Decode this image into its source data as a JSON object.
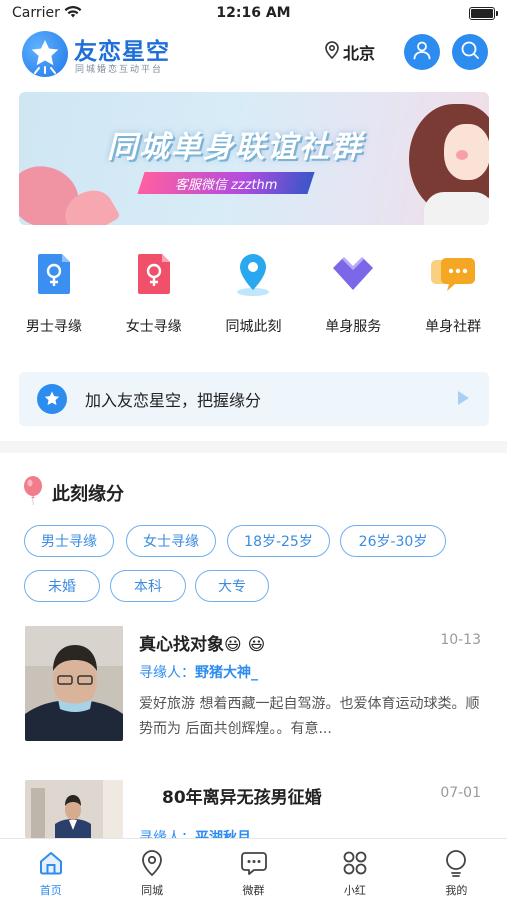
{
  "status_bar": {
    "carrier": "Carrier",
    "time": "12:16 AM"
  },
  "header": {
    "app_name": "友恋星空",
    "subtitle": "同城婚恋互动平台",
    "city": "北京"
  },
  "banner": {
    "title": "同城单身联谊社群",
    "ribbon": "客服微信 zzzthm"
  },
  "nav_items": [
    {
      "label": "男士寻缘",
      "icon": "male-icon",
      "color": "#3a8ff0"
    },
    {
      "label": "女士寻缘",
      "icon": "female-icon",
      "color": "#f0506a"
    },
    {
      "label": "同城此刻",
      "icon": "location-pin-icon",
      "color": "#29a8f0"
    },
    {
      "label": "单身服务",
      "icon": "diamond-heart-icon",
      "color": "#7a68e8"
    },
    {
      "label": "单身社群",
      "icon": "chat-bubbles-icon",
      "color": "#f5a623"
    }
  ],
  "join_bar": {
    "text": "加入友恋星空，把握缘分"
  },
  "section": {
    "title": "此刻缘分"
  },
  "tags": [
    "男士寻缘",
    "女士寻缘",
    "18岁-25岁",
    "26岁-30岁",
    "未婚",
    "本科",
    "大专"
  ],
  "posts": [
    {
      "title": "真心找对象😃 😃",
      "date": "10-13",
      "author_label": "寻缘人：",
      "author_name": "野猪大神_",
      "desc": "爱好旅游 想着西藏一起自驾游。也爱体育运动球类。顺势而为 后面共创辉煌。。有意..."
    },
    {
      "title": "80年离异无孩男征婚",
      "date": "07-01",
      "author_label": "寻缘人：",
      "author_name": "平湖秋月",
      "desc": ""
    }
  ],
  "tabbar": [
    {
      "label": "首页",
      "icon": "home-icon",
      "active": true
    },
    {
      "label": "同城",
      "icon": "location-icon",
      "active": false
    },
    {
      "label": "微群",
      "icon": "chat-icon",
      "active": false
    },
    {
      "label": "小红",
      "icon": "grid-icon",
      "active": false
    },
    {
      "label": "我的",
      "icon": "profile-icon",
      "active": false
    }
  ],
  "colors": {
    "brand": "#2d8cf0",
    "tag_border": "#6fb0ee",
    "join_bg": "#eef6fc"
  }
}
